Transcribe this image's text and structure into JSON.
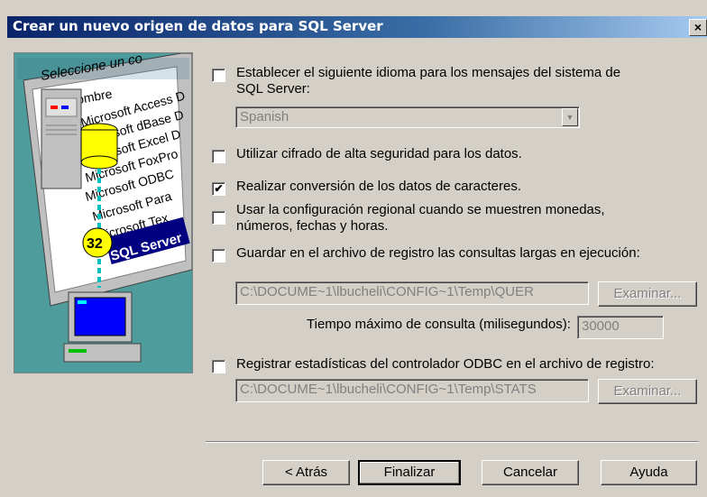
{
  "window": {
    "title": "Crear un nuevo origen de datos para SQL Server",
    "close_label": "×"
  },
  "illustration": {
    "header": "Seleccione un co",
    "column": "Nombre",
    "drivers": [
      "Microsoft Access D",
      "Microsoft dBase D",
      "Microsoft Excel D",
      "Microsoft FoxPro",
      "Microsoft ODBC",
      "Microsoft Para",
      "Microsoft Tex",
      "SQL Server"
    ],
    "badge": "32"
  },
  "options": {
    "language": {
      "checked": false,
      "label_line1": "Establecer el siguiente idioma para los mensajes del sistema de",
      "label_line2": "SQL Server:",
      "value": "Spanish"
    },
    "encryption": {
      "checked": false,
      "label": "Utilizar cifrado de alta seguridad para los datos."
    },
    "char_conversion": {
      "checked": true,
      "mark": "✔",
      "label": "Realizar conversión de los datos de caracteres."
    },
    "regional": {
      "checked": false,
      "label_line1": "Usar la configuración regional cuando se muestren monedas,",
      "label_line2": "números, fechas y horas."
    },
    "long_queries": {
      "checked": false,
      "label": "Guardar en el archivo de registro las consultas largas en ejecución:",
      "path": "C:\\DOCUME~1\\lbucheli\\CONFIG~1\\Temp\\QUER",
      "browse": "Examinar...",
      "timeout_label": "Tiempo máximo de consulta (milisegundos):",
      "timeout_value": "30000"
    },
    "stats": {
      "checked": false,
      "label": "Registrar estadísticas del controlador ODBC en el archivo de registro:",
      "path": "C:\\DOCUME~1\\lbucheli\\CONFIG~1\\Temp\\STATS",
      "browse": "Examinar..."
    }
  },
  "buttons": {
    "back": "< Atrás",
    "finish": "Finalizar",
    "cancel": "Cancelar",
    "help": "Ayuda"
  }
}
